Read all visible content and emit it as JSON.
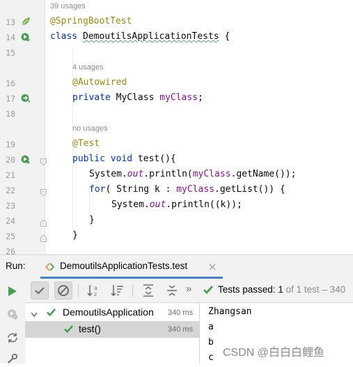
{
  "editor": {
    "top_hint": "39 usages",
    "lines": [
      {
        "num": "13",
        "text": "@SpringBootTest"
      },
      {
        "num": "14",
        "text": "class DemoutilsApplicationTests {"
      },
      {
        "num": "15",
        "text": ""
      },
      {
        "num": "16",
        "text": "@Autowired",
        "hint": "4 usages"
      },
      {
        "num": "17",
        "text": "private MyClass myClass;"
      },
      {
        "num": "18",
        "text": ""
      },
      {
        "num": "19",
        "text": "@Test",
        "hint": "no usages"
      },
      {
        "num": "20",
        "text": "public void test(){"
      },
      {
        "num": "21",
        "text": "System.out.println(myClass.getName());"
      },
      {
        "num": "22",
        "text": "for( String k : myClass.getList()) {"
      },
      {
        "num": "23",
        "text": "System.out.println((k));"
      },
      {
        "num": "24",
        "text": "}"
      },
      {
        "num": "25",
        "text": "}"
      },
      {
        "num": "26",
        "text": ""
      }
    ],
    "tokens": {
      "spring_boot_test": "@SpringBootTest",
      "class_kw": "class",
      "class_name": "DemoutilsApplicationTests",
      "open_brace": "{",
      "autowired": "@Autowired",
      "private_kw": "private",
      "myclass_type": "MyClass",
      "myclass_field": "myClass",
      "semicolon": ";",
      "test_ann": "@Test",
      "public_kw": "public",
      "void_kw": "void",
      "test_method": "test(){",
      "system": "System.",
      "out": "out",
      "println_open": ".println(",
      "get_name": ".getName());",
      "for_kw": "for",
      "for_mid": "( String k : ",
      "get_list": ".getList()) {",
      "println_k": ".println((k));",
      "close_brace": "}"
    }
  },
  "run_panel": {
    "label": "Run:",
    "tab_title": "DemoutilsApplicationTests.test",
    "status_text": "Tests passed:",
    "status_count": "1",
    "status_rest": "of 1 test – 340",
    "tree": [
      {
        "label": "DemoutilsApplication",
        "time": "340 ms"
      },
      {
        "label": "test()",
        "time": "340 ms"
      }
    ],
    "console_lines": [
      "Zhangsan",
      "a",
      "b",
      "c"
    ]
  },
  "watermark": "CSDN @白白白鲤鱼",
  "colors": {
    "annotation": "#9e880d",
    "keyword": "#0033b3",
    "field": "#871094",
    "pass_green": "#3d9c4a",
    "run_green": "#499c54"
  },
  "icons": [
    "spring-bean-icon",
    "run-test-icon",
    "fold-icon",
    "test-tab-icon",
    "close-icon",
    "rerun-icon",
    "toggle-passed-icon",
    "toggle-ignored-icon",
    "sort-alpha-icon",
    "sort-duration-icon",
    "expand-all-icon",
    "collapse-all-icon",
    "more-icon",
    "check-icon"
  ]
}
